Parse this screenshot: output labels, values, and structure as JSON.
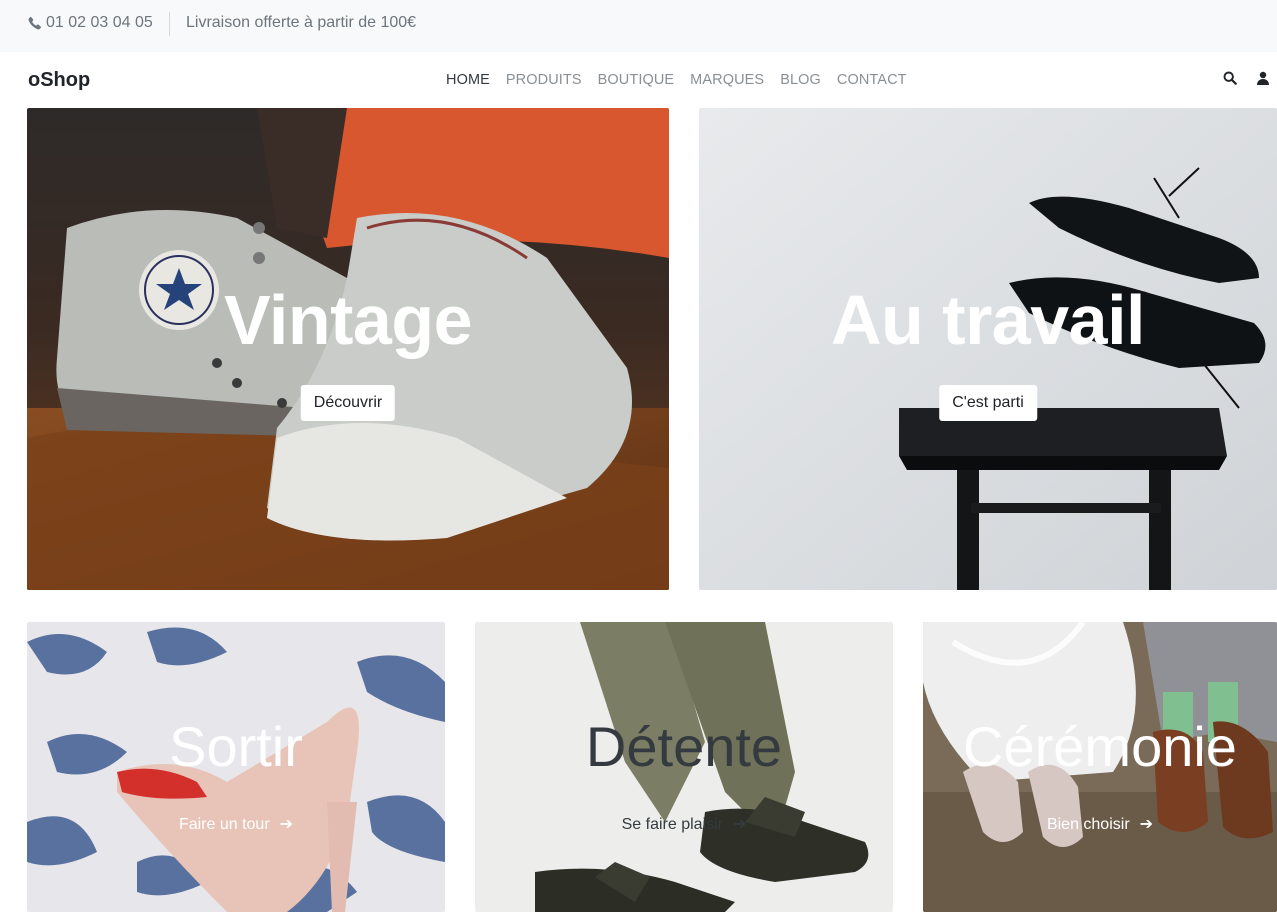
{
  "topbar": {
    "phone_icon": "phone-icon",
    "phone": "01 02 03 04 05",
    "promo": "Livraison offerte à partir de 100€"
  },
  "navbar": {
    "brand": "oShop",
    "items": [
      {
        "label": "HOME",
        "active": true
      },
      {
        "label": "PRODUITS",
        "active": false
      },
      {
        "label": "BOUTIQUE",
        "active": false
      },
      {
        "label": "MARQUES",
        "active": false
      },
      {
        "label": "BLOG",
        "active": false
      },
      {
        "label": "CONTACT",
        "active": false
      }
    ],
    "icons": [
      "search-icon",
      "user-icon"
    ]
  },
  "hero": [
    {
      "title": "Vintage",
      "button": "Découvrir"
    },
    {
      "title": "Au travail",
      "button": "C'est parti"
    }
  ],
  "categories": [
    {
      "title": "Sortir",
      "link": "Faire un tour"
    },
    {
      "title": "Détente",
      "link": "Se faire plaisir"
    },
    {
      "title": "Cérémonie",
      "link": "Bien choisir"
    }
  ],
  "colors": {
    "topbar_bg": "#f8f9fa",
    "text_muted": "#6c757d",
    "nav_active": "#343a40",
    "button_bg": "#ffffff"
  }
}
